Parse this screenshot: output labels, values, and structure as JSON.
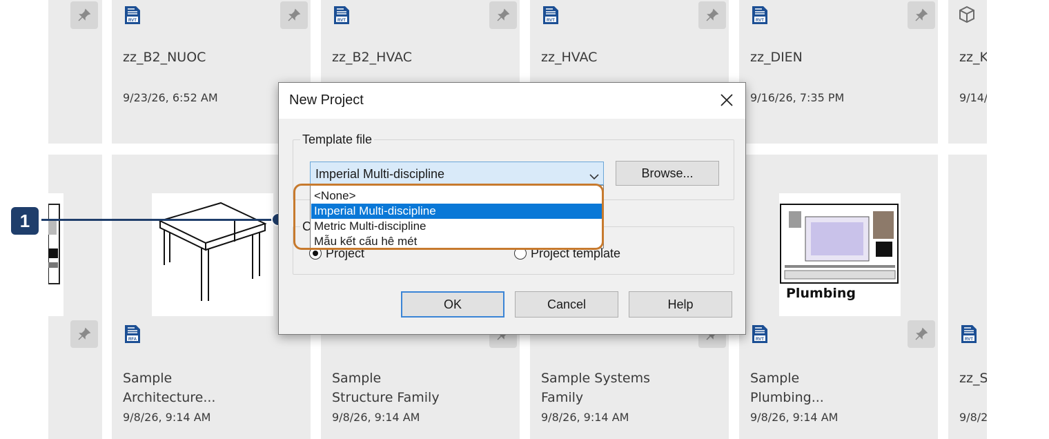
{
  "gallery": {
    "top_row": [
      {
        "name": "zz_B2_NUOC",
        "date": "9/23/26, 6:52 AM",
        "file_type": "RVT"
      },
      {
        "name": "zz_B2_HVAC",
        "date": "",
        "file_type": "RVT"
      },
      {
        "name": "zz_HVAC",
        "date": "",
        "file_type": "RVT"
      },
      {
        "name": "zz_DIEN",
        "date": "9/16/26, 7:35 PM",
        "file_type": "RVT"
      },
      {
        "name": "zz_K",
        "date": "9/14/",
        "file_type": "cloud"
      }
    ],
    "bottom_row": [
      {
        "name": "Sample Architecture...",
        "line1": "Sample",
        "line2": "Architecture...",
        "date": "9/8/26, 9:14 AM",
        "file_type": "RFA"
      },
      {
        "name": "Sample Structure Family",
        "line1": "Sample",
        "line2": "Structure Family",
        "date": "9/8/26, 9:14 AM",
        "file_type": "RFA"
      },
      {
        "name": "Sample Systems Family",
        "line1": "Sample Systems",
        "line2": "Family",
        "date": "9/8/26, 9:14 AM",
        "file_type": "RFA"
      },
      {
        "name": "Sample Plumbing...",
        "line1": "Sample",
        "line2": "Plumbing...",
        "date": "9/8/26, 9:14 AM",
        "file_type": "RVT"
      },
      {
        "name": "zz_S",
        "line1": "zz_S",
        "line2": "",
        "date": "9/8/2",
        "file_type": "RVT"
      }
    ],
    "plumbing_thumb_caption": "Plumbing"
  },
  "callout": {
    "number": "1"
  },
  "dialog": {
    "title": "New Project",
    "template_group_label": "Template file",
    "template_selected": "Imperial Multi-discipline",
    "browse_label": "Browse...",
    "dropdown_options": [
      "<None>",
      "Imperial Multi-discipline",
      "Metric Multi-discipline",
      "Mẫu kết cấu hê mét"
    ],
    "dropdown_selected_index": 1,
    "create_new_label_fragment": "C",
    "radio_project": "Project",
    "radio_template": "Project template",
    "ok_label": "OK",
    "cancel_label": "Cancel",
    "help_label": "Help"
  },
  "colors": {
    "accent": "#0a78d7",
    "callout": "#1f3e6b",
    "highlight": "#c77a2e",
    "file_icon": "#1c4f94"
  }
}
